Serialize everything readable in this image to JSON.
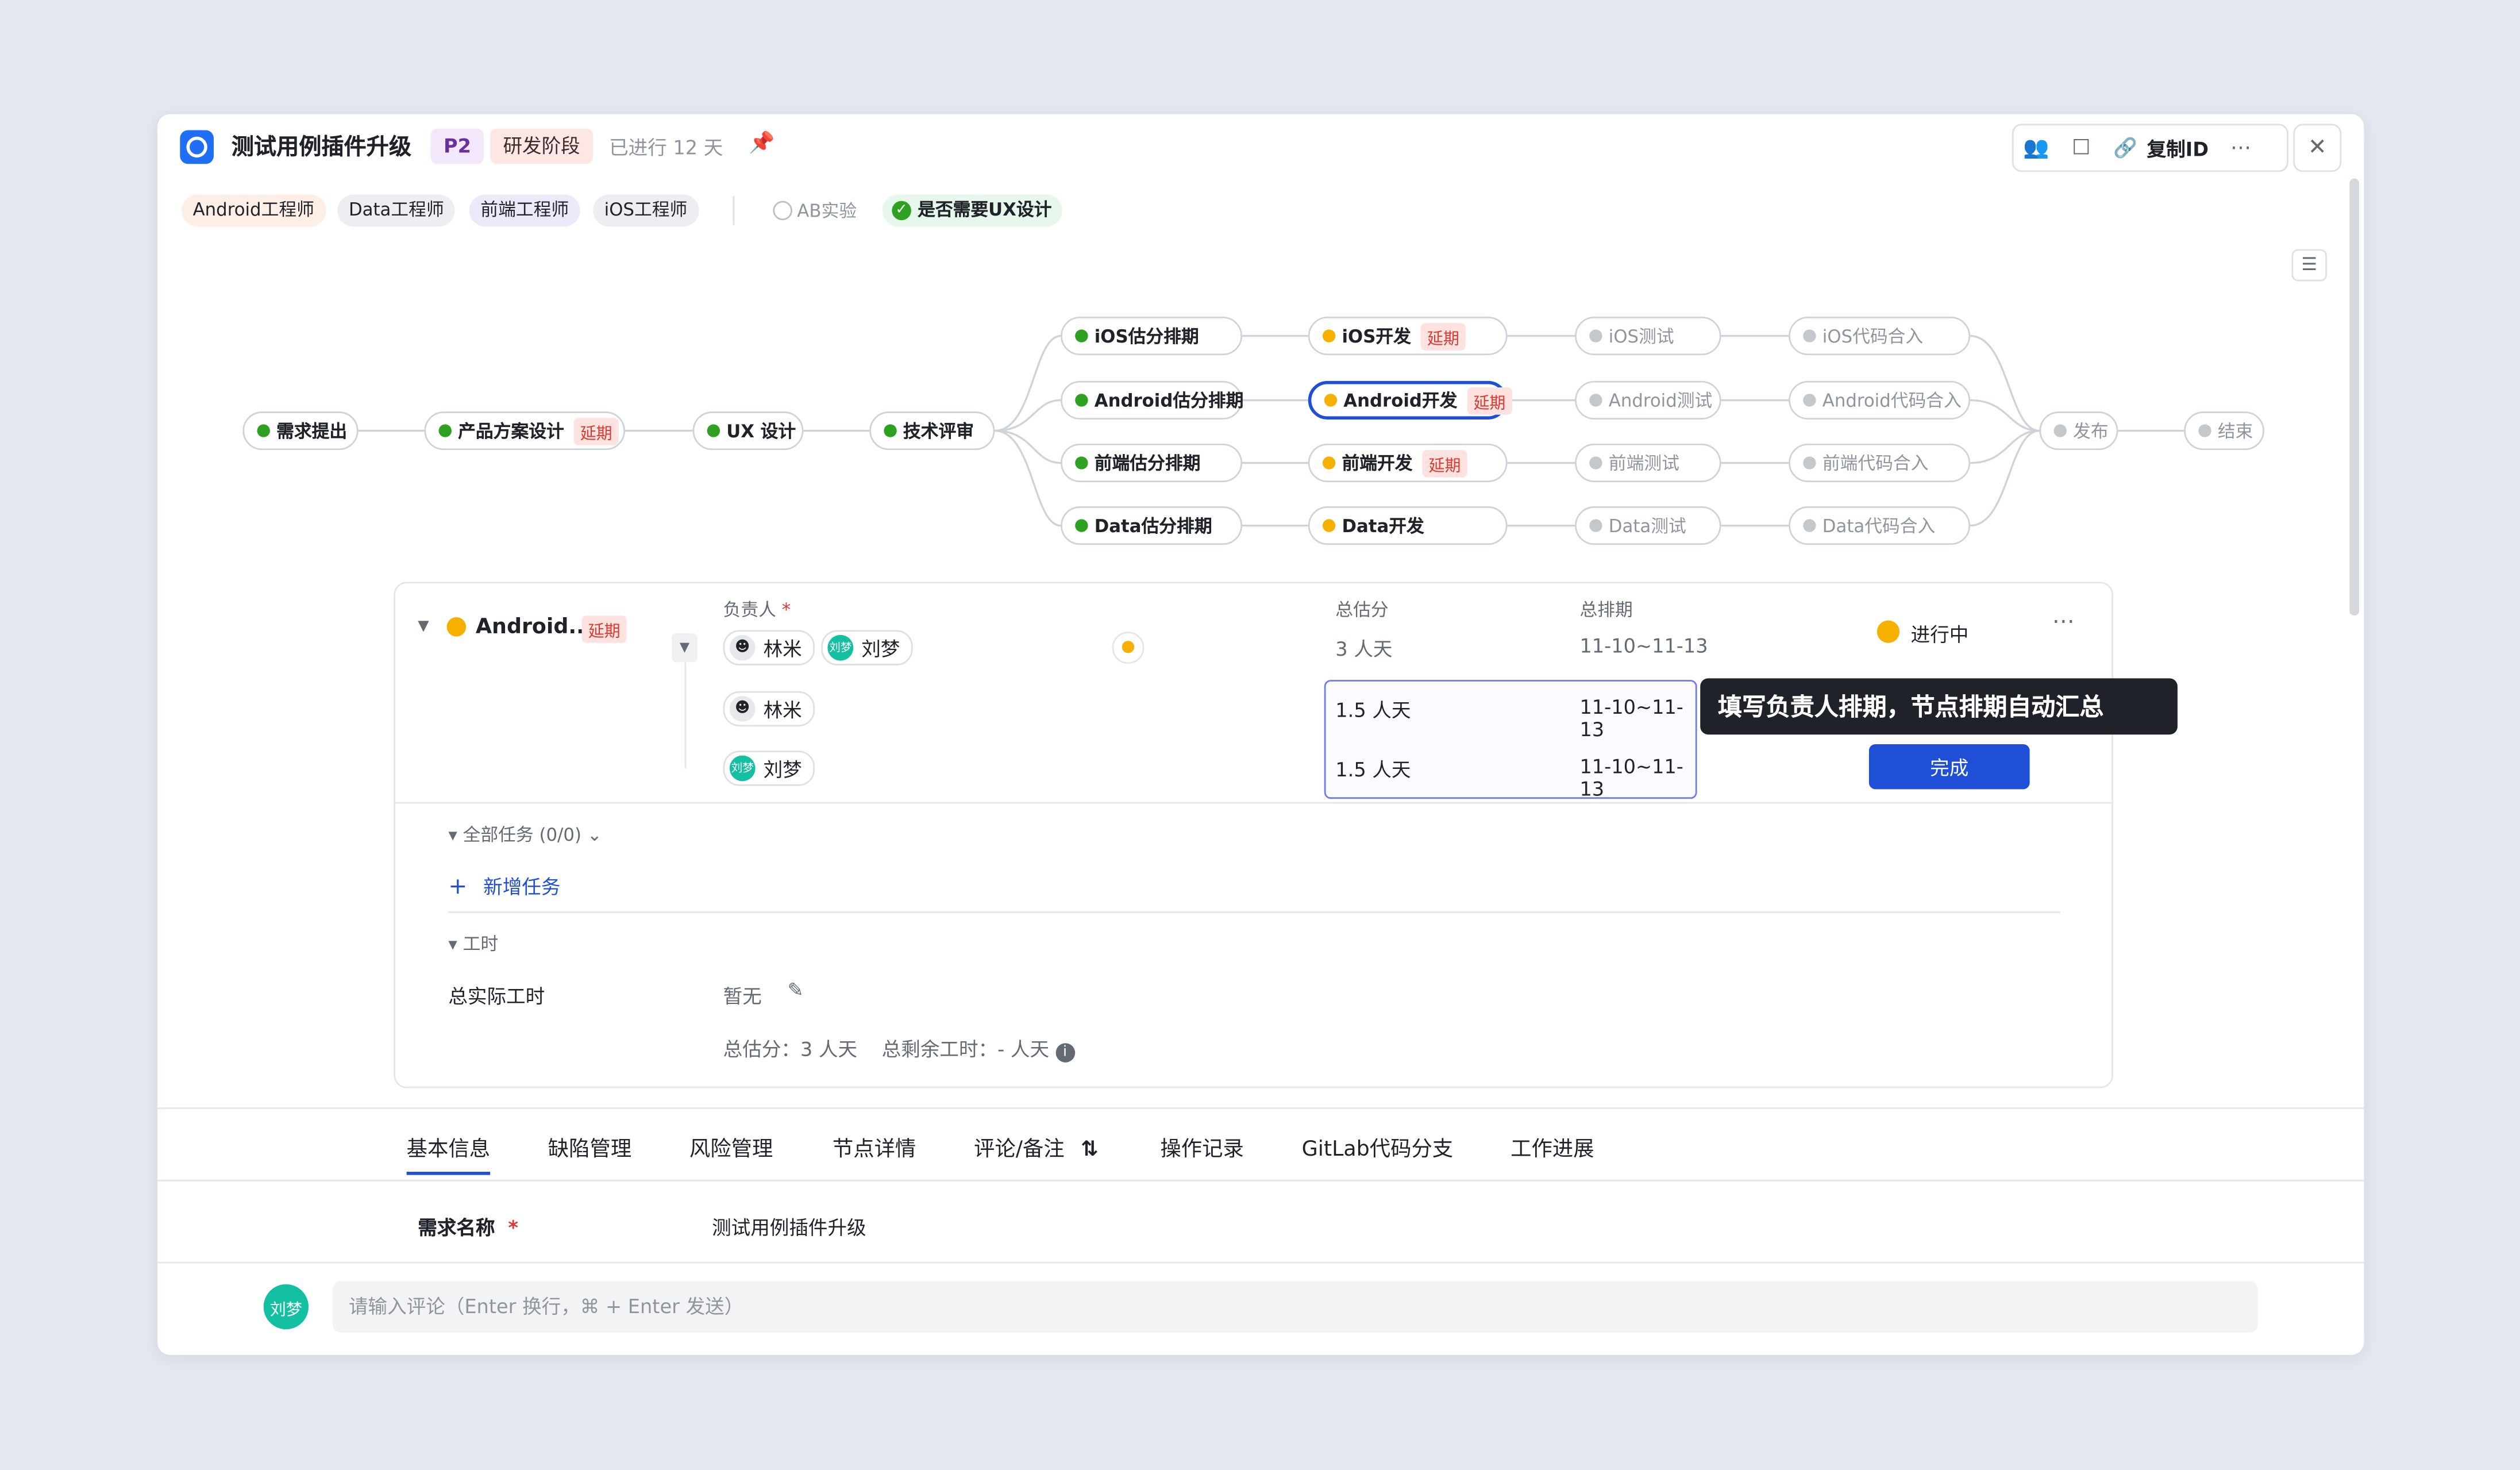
{
  "header": {
    "title": "测试用例插件升级",
    "priority": "P2",
    "stage": "研发阶段",
    "elapsed": "已进行 12 天",
    "copy_id": "复制ID"
  },
  "roles": [
    "Android工程师",
    "Data工程师",
    "前端工程师",
    "iOS工程师"
  ],
  "options": {
    "ab_label": "AB实验",
    "ux_label": "是否需要UX设计"
  },
  "flow": {
    "late_label": "延期",
    "main": [
      "需求提出",
      "产品方案设计",
      "UX 设计",
      "技术评审"
    ],
    "rows": [
      [
        "iOS估分排期",
        "iOS开发",
        "iOS测试",
        "iOS代码合入"
      ],
      [
        "Android估分排期",
        "Android开发",
        "Android测试",
        "Android代码合入"
      ],
      [
        "前端估分排期",
        "前端开发",
        "前端测试",
        "前端代码合入"
      ],
      [
        "Data估分排期",
        "Data开发",
        "Data测试",
        "Data代码合入"
      ]
    ],
    "end": [
      "发布",
      "结束"
    ]
  },
  "detail": {
    "node_name": "Android...",
    "late": "延期",
    "owner_label": "负责人",
    "estimate_label": "总估分",
    "schedule_label": "总排期",
    "owners": [
      "林米",
      "刘梦"
    ],
    "total_estimate": "3 人天",
    "total_schedule": "11-10~11-13",
    "rows": [
      {
        "name": "林米",
        "estimate": "1.5 人天",
        "schedule": "11-10~11-13"
      },
      {
        "name": "刘梦",
        "estimate": "1.5 人天",
        "schedule": "11-10~11-13"
      }
    ],
    "status": "进行中",
    "tooltip": "填写负责人排期，节点排期自动汇总",
    "done_button": "完成",
    "tasks_label": "全部任务 (0/0)",
    "add_task": "新增任务",
    "worktime_label": "工时",
    "actual_label": "总实际工时",
    "actual_value": "暂无",
    "summary": "总估分：3 人天    总剩余工时：- 人天"
  },
  "tabs": [
    "基本信息",
    "缺陷管理",
    "风险管理",
    "节点详情",
    "评论/备注",
    "操作记录",
    "GitLab代码分支",
    "工作进展"
  ],
  "basic": {
    "field_label": "需求名称",
    "field_value": "测试用例插件升级"
  },
  "comment": {
    "avatar": "刘梦",
    "placeholder": "请输入评论（Enter 换行，⌘ + Enter 发送）"
  },
  "colors": {
    "accent": "#1f4fd6",
    "success": "#2ea121",
    "warning": "#f5b000",
    "late_bg": "#fde2e0"
  }
}
